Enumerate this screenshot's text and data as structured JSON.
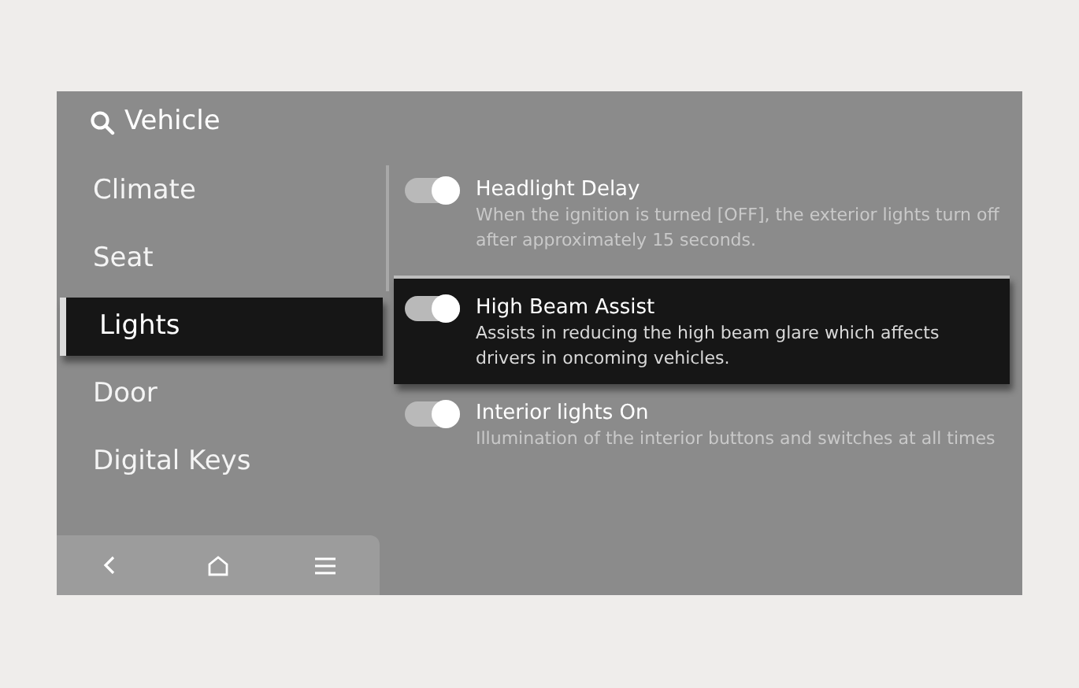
{
  "header": {
    "title": "Vehicle"
  },
  "menu": [
    {
      "label": "Climate",
      "selected": false
    },
    {
      "label": "Seat",
      "selected": false
    },
    {
      "label": "Lights",
      "selected": true
    },
    {
      "label": "Door",
      "selected": false
    },
    {
      "label": "Digital Keys",
      "selected": false
    }
  ],
  "settings": [
    {
      "title": "Headlight Delay",
      "description": "When the ignition is turned [OFF], the exterior lights turn off after approximately 15 seconds.",
      "on": true,
      "selected": false
    },
    {
      "title": "High Beam Assist",
      "description": "Assists in reducing the high beam glare which affects drivers in oncoming vehicles.",
      "on": true,
      "selected": true
    },
    {
      "title": "Interior lights On",
      "description": "Illumination of the interior buttons and switches at all times",
      "on": true,
      "selected": false
    }
  ],
  "nav_bar": {
    "buttons": [
      {
        "kind": "back"
      },
      {
        "kind": "home"
      },
      {
        "kind": "menu"
      }
    ]
  }
}
